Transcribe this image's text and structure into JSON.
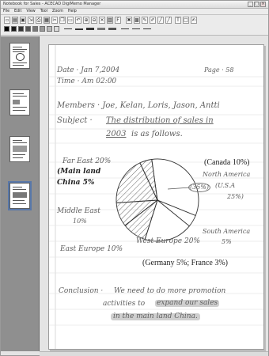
{
  "window": {
    "title": "Notebook for Sales - ACECAD DigiMemo Manager",
    "controls": [
      "_",
      "□",
      "×"
    ]
  },
  "menu": [
    "File",
    "Edit",
    "View",
    "Tool",
    "Zoom",
    "Help"
  ],
  "toolbar": {
    "colors": [
      "#000000",
      "#1a1a1a",
      "#333333",
      "#555555",
      "#777777",
      "#999999",
      "#bbbbbb",
      "#dddddd"
    ],
    "text_tool": "T",
    "pen_widths_count": 5
  },
  "thumbnails": [
    {
      "name": "page-1"
    },
    {
      "name": "page-2"
    },
    {
      "name": "page-3"
    },
    {
      "name": "page-4"
    }
  ],
  "note": {
    "date": "Date · Jan 7,2004",
    "time": "Time · Am 02:00",
    "page": "Page · 58",
    "members": "Members · Joe, Kelan, Loris, Jason, Antti",
    "subject_label": "Subject ·",
    "subject_line1": "The distribution of sales in",
    "subject_line2": "2003",
    "subject_line2b": "is as follows.",
    "pie_labels": {
      "far_east": "Far East 20%",
      "main_land": "(Main land",
      "china": "China 5%",
      "middle_east": "Middle East",
      "middle_east_pct": "10%",
      "east_europe": "East Europe 10%",
      "west_europe": "West Europe 20%",
      "south_america": "South America",
      "south_america_pct": "5%",
      "north_america": "North America",
      "usa": "(35%)",
      "usa_b": "(U.S.A",
      "usa_c": "25%)"
    },
    "typed_canada": "(Canada 10%)",
    "typed_germany": "(Germany 5%; France 3%)",
    "conclusion_label": "Conclusion ·",
    "conclusion_line1": "We need to do more promotion",
    "conclusion_line2a": "activities to",
    "conclusion_line2b": "expand our sales",
    "conclusion_line3": "in the main land China."
  },
  "chart_data": {
    "type": "pie",
    "categories": [
      "North America",
      "Far East",
      "West Europe",
      "East Europe",
      "Middle East",
      "South America",
      "Main land China"
    ],
    "values": [
      35,
      20,
      20,
      10,
      10,
      5,
      5
    ],
    "title": "",
    "xlabel": "",
    "ylabel": ""
  }
}
